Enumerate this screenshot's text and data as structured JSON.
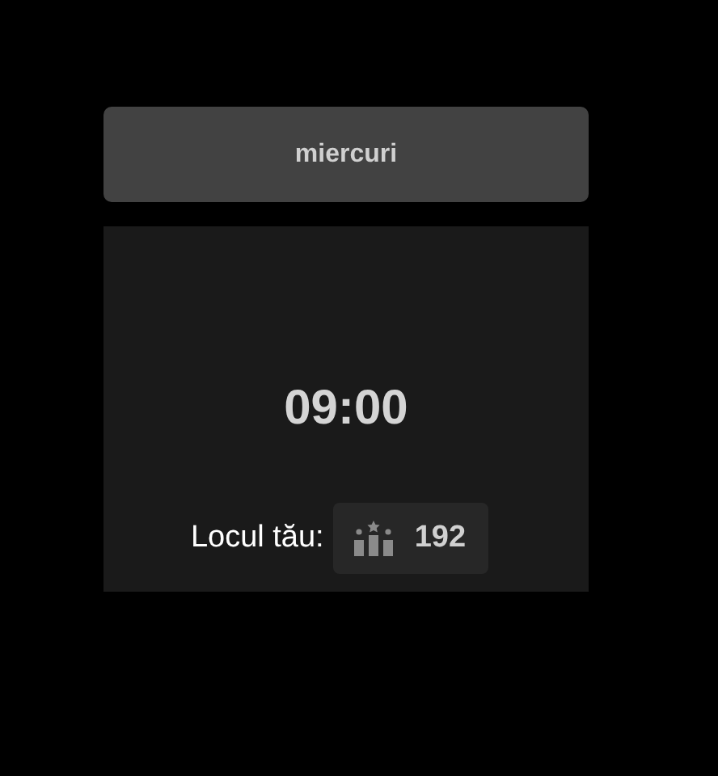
{
  "day_button": {
    "label": "miercuri"
  },
  "panel": {
    "time": "09:00",
    "rank_label": "Locul tău:",
    "rank": "192"
  }
}
